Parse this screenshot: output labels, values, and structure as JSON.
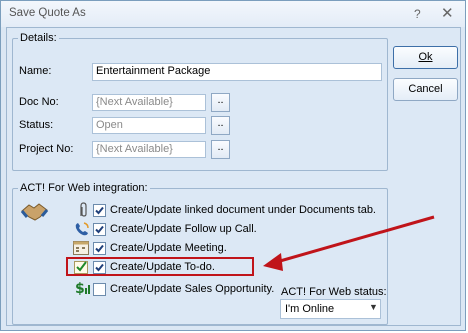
{
  "window": {
    "title": "Save Quote As",
    "help_glyph": "?",
    "close_glyph": "✕"
  },
  "details": {
    "group_title": "Details:",
    "name_label": "Name:",
    "name_value": "Entertainment Package",
    "doc_no_label": "Doc No:",
    "doc_no_value": "{Next Available}",
    "status_label": "Status:",
    "status_value": "Open",
    "project_no_label": "Project No:",
    "project_no_value": "{Next Available}",
    "browse_label": ".."
  },
  "buttons": {
    "ok_label": "Ok",
    "cancel_label": "Cancel"
  },
  "act": {
    "group_title": "ACT! For Web integration:",
    "options": [
      {
        "label": "Create/Update linked document under Documents tab.",
        "checked": true,
        "icon": "paperclip-icon"
      },
      {
        "label": "Create/Update Follow up Call.",
        "checked": true,
        "icon": "phone-icon"
      },
      {
        "label": "Create/Update Meeting.",
        "checked": true,
        "icon": "calendar-icon"
      },
      {
        "label": "Create/Update To-do.",
        "checked": true,
        "icon": "todo-checkmark-icon"
      },
      {
        "label": "Create/Update Sales Opportunity.",
        "checked": false,
        "icon": "dollar-icon"
      }
    ],
    "status_label": "ACT! For Web status:",
    "status_value": "I'm Online"
  },
  "colors": {
    "highlight": "#c0141a",
    "annotation_arrow": "#c0141a"
  }
}
